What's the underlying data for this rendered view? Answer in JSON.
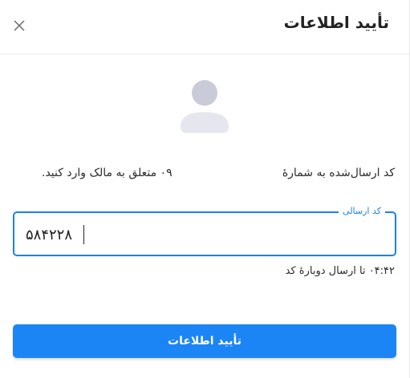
{
  "header": {
    "title": "تأیید اطلاعات"
  },
  "message": {
    "part_right": "کد ارسال‌شده به شمارهٔ",
    "part_left": "۰۹ متعلق به مالک وارد کنید."
  },
  "code_field": {
    "label": "کد ارسالی",
    "value": "۵۸۴۲۲۸"
  },
  "timer": {
    "text": "۰۴:۴۲ تا ارسال دوبارهٔ کد"
  },
  "submit": {
    "label": "تأیید اطلاعات"
  },
  "colors": {
    "accent": "#1c85f5",
    "border_focus": "#1e7ef0",
    "avatar": "#c9cbd8"
  }
}
